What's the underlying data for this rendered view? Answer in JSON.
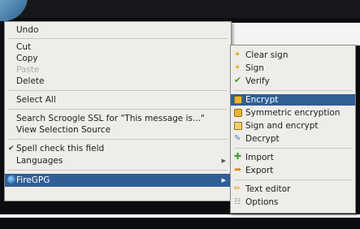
{
  "main_menu": {
    "items": [
      {
        "label": "Undo"
      },
      {
        "label": "Cut"
      },
      {
        "label": "Copy"
      },
      {
        "label": "Paste",
        "disabled": true
      },
      {
        "label": "Delete"
      },
      {
        "label": "Select All"
      },
      {
        "label": "Search Scroogle SSL for \"This message is...\""
      },
      {
        "label": "View Selection Source"
      },
      {
        "label": "Spell check this field",
        "checked": true
      },
      {
        "label": "Languages",
        "submenu": true
      },
      {
        "label": "FireGPG",
        "submenu": true,
        "selected": true
      }
    ]
  },
  "firegpg_submenu": {
    "items": [
      {
        "label": "Clear sign",
        "icon": "sparkle-icon"
      },
      {
        "label": "Sign",
        "icon": "sparkle-icon"
      },
      {
        "label": "Verify",
        "icon": "checkmark-icon"
      },
      {
        "label": "Encrypt",
        "icon": "lock-icon",
        "selected": true
      },
      {
        "label": "Symmetric encryption",
        "icon": "lock-icon"
      },
      {
        "label": "Sign and encrypt",
        "icon": "envelope-icon"
      },
      {
        "label": "Decrypt",
        "icon": "pen-icon"
      },
      {
        "label": "Import",
        "icon": "import-icon"
      },
      {
        "label": "Export",
        "icon": "export-icon"
      },
      {
        "label": "Text editor",
        "icon": "edit-icon"
      },
      {
        "label": "Options",
        "icon": "options-icon"
      }
    ]
  },
  "colors": {
    "menu_bg": "#eeede9",
    "highlight": "#2f5f95",
    "disabled_text": "#b0aea8"
  }
}
